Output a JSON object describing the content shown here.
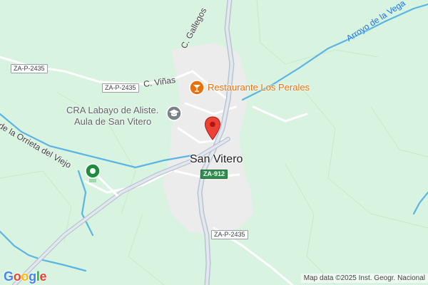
{
  "map": {
    "place_name": "San Vitero",
    "labels": {
      "street_gallegos": "C. Gallegos",
      "street_vinas": "C. Viñas",
      "stream_orrieta": "de la Orrieta del Viejo",
      "stream_vega": "Arroyo de la Vega"
    },
    "road_shields": {
      "za_p_2435_west": "ZA-P-2435",
      "za_p_2435_center": "ZA-P-2435",
      "za_912": "ZA-912",
      "za_p_2435_south": "ZA-P-2435"
    },
    "pois": {
      "restaurant": {
        "name": "Restaurante Los Perales",
        "icon": "cocktail-icon",
        "color": "#e8710a"
      },
      "school": {
        "name_line1": "CRA Labayo de Aliste.",
        "name_line2": "Aula de San Vitero",
        "icon": "school-icon",
        "color": "#5f6368"
      },
      "green_marker": {
        "icon": "place-icon",
        "color": "#1e8e3e"
      }
    },
    "selected_pin": {
      "icon": "map-pin-icon",
      "color": "#ea4335"
    },
    "branding": {
      "logo": "Google",
      "attribution": "Map data ©2025 Inst. Geogr. Nacional"
    },
    "colors": {
      "land": "#d8f3df",
      "town_area": "#ececec",
      "water": "#5ab4e5",
      "road": "#ffffff",
      "highway": "#b9c3d3"
    }
  }
}
